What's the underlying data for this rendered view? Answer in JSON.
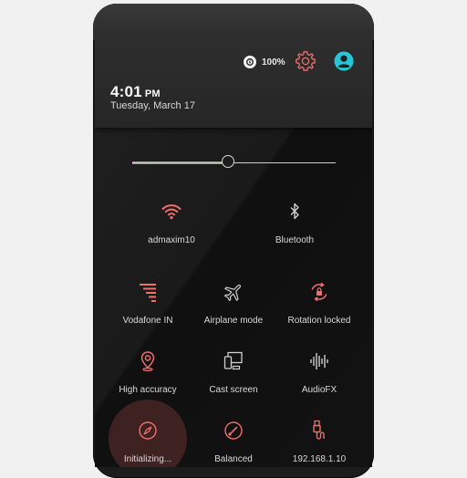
{
  "status": {
    "battery_text": "100%",
    "battery_level": 100,
    "time": "4:01",
    "ampm": "PM",
    "date": "Tuesday, March 17"
  },
  "brightness": {
    "level": 0.47
  },
  "colors": {
    "accent": "#ef6f6c",
    "avatar": "#26c6da",
    "label": "#d9d9d9",
    "inactive_icon": "#cfcfcf"
  },
  "tiles": [
    {
      "label": "admaxim10",
      "icon": "wifi-icon",
      "active": true
    },
    {
      "label": "Bluetooth",
      "icon": "bluetooth-icon",
      "active": false
    },
    {
      "label": "Vodafone IN",
      "icon": "cellular-signal-icon",
      "active": true
    },
    {
      "label": "Airplane mode",
      "icon": "airplane-icon",
      "active": false
    },
    {
      "label": "Rotation locked",
      "icon": "rotation-lock-icon",
      "active": true
    },
    {
      "label": "High accuracy",
      "icon": "location-icon",
      "active": true
    },
    {
      "label": "Cast screen",
      "icon": "cast-screen-icon",
      "active": false
    },
    {
      "label": "AudioFX",
      "icon": "audio-fx-icon",
      "active": false
    },
    {
      "label": "Initializing...",
      "icon": "compass-icon",
      "active": true
    },
    {
      "label": "Balanced",
      "icon": "performance-gauge-icon",
      "active": true
    },
    {
      "label": "192.168.1.10",
      "icon": "usb-debugging-icon",
      "active": true
    }
  ]
}
